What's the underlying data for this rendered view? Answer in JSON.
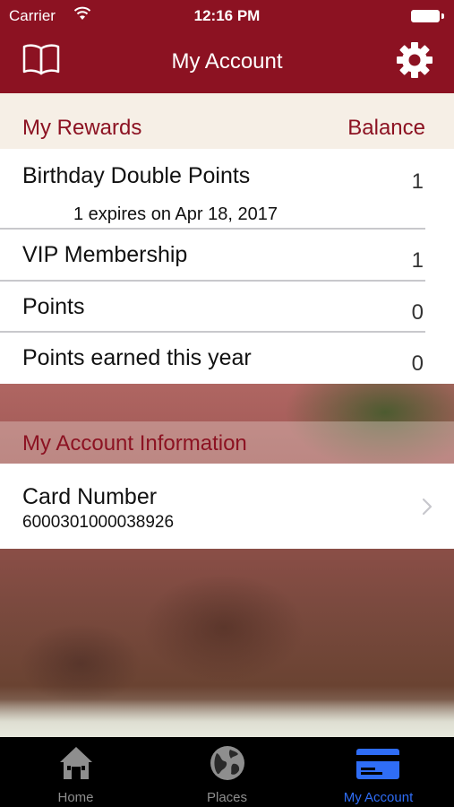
{
  "status_bar": {
    "carrier": "Carrier",
    "time": "12:16 PM"
  },
  "nav": {
    "title": "My Account",
    "left_icon": "book-icon",
    "right_icon": "gear-icon"
  },
  "rewards": {
    "header_left": "My Rewards",
    "header_right": "Balance",
    "items": [
      {
        "label": "Birthday Double Points",
        "value": "1",
        "sub": "1 expires on Apr 18, 2017"
      },
      {
        "label": "VIP Membership",
        "value": "1"
      },
      {
        "label": "Points",
        "value": "0"
      },
      {
        "label": "Points earned this year",
        "value": "0"
      }
    ]
  },
  "account_info": {
    "header": "My Account Information",
    "card_label": "Card Number",
    "card_number": "6000301000038926"
  },
  "tabbar": {
    "tabs": [
      {
        "label": "Home",
        "icon": "house-icon"
      },
      {
        "label": "Places",
        "icon": "globe-icon"
      },
      {
        "label": "My Account",
        "icon": "credit-card-icon",
        "active": true
      }
    ],
    "active_color": "#2f6df6"
  },
  "colors": {
    "brand": "#8c1222",
    "header_bg": "#f6efe6"
  }
}
